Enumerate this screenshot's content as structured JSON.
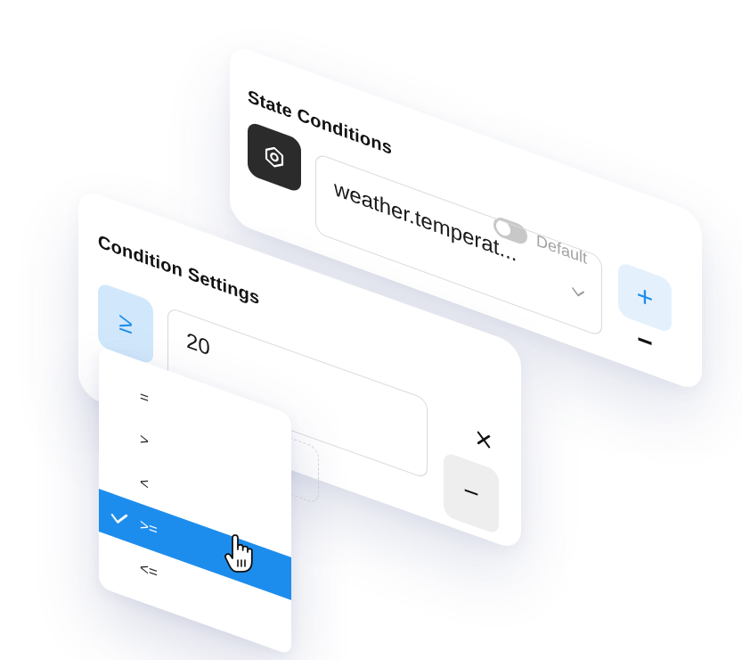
{
  "state_conditions": {
    "title": "State Conditions",
    "toggle_label": "Default",
    "entity_value": "weather.temperat...",
    "icons": {
      "entity": "gear-icon",
      "dropdown": "chevron-down-icon",
      "add": "plus-icon",
      "remove": "minus-icon"
    },
    "add_label": "+",
    "remove_label": "−"
  },
  "condition_settings": {
    "title": "Condition Settings",
    "operator_symbol": "≥",
    "value": "20",
    "remove_label": "−",
    "icons": {
      "clear": "close-icon"
    }
  },
  "operator_dropdown": {
    "options": [
      "=",
      ">",
      "<",
      ">=",
      "<=",
      "≠"
    ],
    "selected_index": 3
  },
  "colors": {
    "accent": "#1d8ded",
    "accent_light": "#d1e8fc",
    "dark_button": "#2b2b2b",
    "muted_text": "#a2a2a2"
  }
}
